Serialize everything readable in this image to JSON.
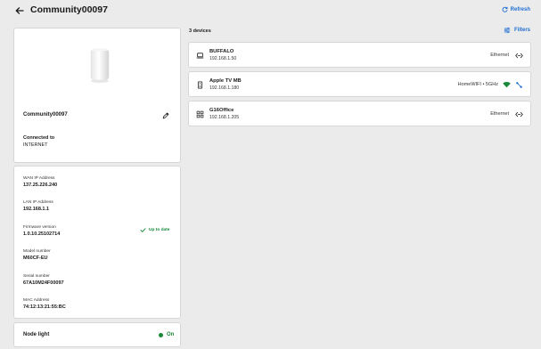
{
  "header": {
    "title": "Community00097",
    "refresh_label": "Refresh"
  },
  "node": {
    "name": "Community00097",
    "connected_label": "Connected to",
    "connected_value": "INTERNET"
  },
  "info": {
    "wan_label": "WAN IP Address",
    "wan_value": "137.25.226.240",
    "lan_label": "LAN IP Address",
    "lan_value": "192.168.1.1",
    "fw_label": "Firmware version",
    "fw_value": "1.0.10.25102714",
    "fw_status": "Up to date",
    "model_label": "Model number",
    "model_value": "M60CF-EU",
    "serial_label": "Serial number",
    "serial_value": "67A10M24F00097",
    "mac_label": "MAC Address",
    "mac_value": "74:12:13:21:55:BC"
  },
  "node_light": {
    "label": "Node light",
    "status": "On"
  },
  "devices": {
    "count_label": "3 devices",
    "filters_label": "Filters",
    "items": [
      {
        "name": "BUFFALO",
        "ip": "192.168.1.50",
        "connection": "Ethernet",
        "icon": "laptop-icon"
      },
      {
        "name": "Apple TV MB",
        "ip": "192.168.1.180",
        "connection": "HomeWIFI • 5GHz",
        "icon": "tv-device-icon"
      },
      {
        "name": "G16Office",
        "ip": "192.168.1.205",
        "connection": "Ethernet",
        "icon": "grid-device-icon"
      }
    ]
  },
  "colors": {
    "accent": "#1f6fd1",
    "success": "#1a8a3a",
    "background": "#ebebeb"
  }
}
